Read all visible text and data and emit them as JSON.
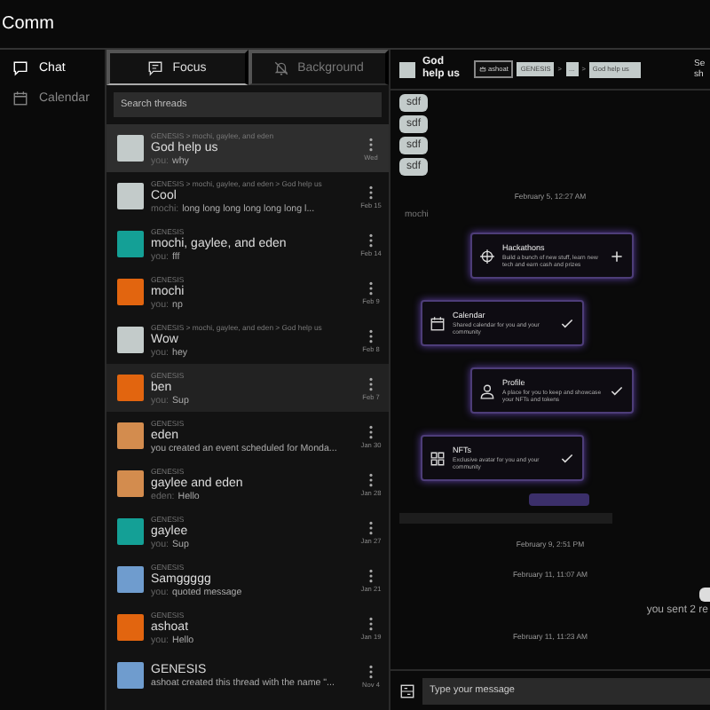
{
  "app": {
    "title": "Comm"
  },
  "nav": [
    {
      "label": "Chat",
      "selected": true
    },
    {
      "label": "Calendar",
      "selected": false
    }
  ],
  "tabs": [
    {
      "label": "Focus",
      "selected": true
    },
    {
      "label": "Background",
      "selected": false
    }
  ],
  "search": {
    "placeholder": "Search threads"
  },
  "threads": [
    {
      "path": "GENESIS > mochi, gaylee, and eden",
      "name": "God help us",
      "sender": "you:",
      "preview": "why",
      "date": "Wed",
      "color": "#c3cbca",
      "selected": true,
      "highlighted": false
    },
    {
      "path": "GENESIS > mochi, gaylee, and eden > God help us",
      "name": "Cool",
      "sender": "mochi:",
      "preview": "long long long long long long l...",
      "date": "Feb 15",
      "color": "#c3cbca",
      "selected": false,
      "highlighted": false
    },
    {
      "path": "GENESIS",
      "name": "mochi, gaylee, and eden",
      "sender": "you:",
      "preview": "fff",
      "date": "Feb 14",
      "color": "#14a096",
      "selected": false,
      "highlighted": false
    },
    {
      "path": "GENESIS",
      "name": "mochi",
      "sender": "you:",
      "preview": "np",
      "date": "Feb 9",
      "color": "#e2650f",
      "selected": false,
      "highlighted": false
    },
    {
      "path": "GENESIS > mochi, gaylee, and eden > God help us",
      "name": "Wow",
      "sender": "you:",
      "preview": "hey",
      "date": "Feb 8",
      "color": "#c3cbca",
      "selected": false,
      "highlighted": false
    },
    {
      "path": "GENESIS",
      "name": "ben",
      "sender": "you:",
      "preview": "Sup",
      "date": "Feb 7",
      "color": "#e2650f",
      "selected": false,
      "highlighted": true
    },
    {
      "path": "GENESIS",
      "name": "eden",
      "preview": "you created an event scheduled for Monda...",
      "date": "Jan 30",
      "color": "#d38c4e",
      "selected": false,
      "highlighted": false
    },
    {
      "path": "GENESIS",
      "name": "gaylee and eden",
      "sender": "eden:",
      "preview": "Hello",
      "date": "Jan 28",
      "color": "#d38c4e",
      "selected": false,
      "highlighted": false
    },
    {
      "path": "GENESIS",
      "name": "gaylee",
      "sender": "you:",
      "preview": "Sup",
      "date": "Jan 27",
      "color": "#14a096",
      "selected": false,
      "highlighted": false
    },
    {
      "path": "GENESIS",
      "name": "Samggggg",
      "sender": "you:",
      "preview": "quoted message",
      "date": "Jan 21",
      "color": "#6f9cce",
      "selected": false,
      "highlighted": false
    },
    {
      "path": "GENESIS",
      "name": "ashoat",
      "sender": "you:",
      "preview": "Hello",
      "date": "Jan 19",
      "color": "#e2650f",
      "selected": false,
      "highlighted": false
    },
    {
      "name": "GENESIS",
      "preview": "ashoat created this thread with the name \"...",
      "date": "Nov 4",
      "color": "#6f9cce",
      "selected": false,
      "highlighted": false
    }
  ],
  "chat": {
    "title": "God help us",
    "breadcrumb": [
      "ashoat",
      "GENESIS",
      ">",
      "...",
      ">",
      "God help us"
    ],
    "cut_action": "Se sh",
    "messages": [
      {
        "kind": "bubble",
        "text": "sdf"
      },
      {
        "kind": "bubble",
        "text": "sdf"
      },
      {
        "kind": "bubble",
        "text": "sdf"
      },
      {
        "kind": "bubble",
        "text": "sdf"
      },
      {
        "kind": "time",
        "text": "February 5, 12:27 AM"
      },
      {
        "kind": "author",
        "text": "mochi"
      },
      {
        "kind": "card",
        "title": "Hackathons",
        "text": "Build a bunch of new stuff, learn new tech and earn cash and prizes",
        "checked": false
      },
      {
        "kind": "card",
        "title": "Calendar",
        "text": "Shared calendar for you and your community",
        "checked": true
      },
      {
        "kind": "card",
        "title": "Profile",
        "text": "A place for you to keep and showcase your NFTs and tokens",
        "checked": true
      },
      {
        "kind": "card",
        "title": "NFTs",
        "text": "Exclusive avatar for you and your community",
        "checked": true
      },
      {
        "kind": "pill"
      },
      {
        "kind": "bar"
      },
      {
        "kind": "time",
        "text": "February 9, 2:51 PM"
      },
      {
        "kind": "time",
        "text": "February 11, 11:07 AM"
      },
      {
        "kind": "own",
        "text": "you sent 2 re"
      },
      {
        "kind": "time",
        "text": "February 11, 11:23 AM"
      }
    ],
    "composer": {
      "placeholder": "Type your message"
    }
  }
}
